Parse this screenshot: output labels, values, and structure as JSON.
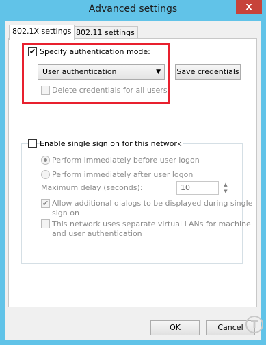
{
  "window": {
    "title": "Advanced settings",
    "close_glyph": "x"
  },
  "tabs": [
    {
      "label": "802.1X settings",
      "active": true
    },
    {
      "label": "802.11 settings",
      "active": false
    }
  ],
  "auth": {
    "specify_label": "Specify authentication mode:",
    "specify_checked": true,
    "mode_value": "User authentication",
    "save_credentials_label": "Save credentials",
    "delete_credentials_label": "Delete credentials for all users",
    "delete_credentials_checked": false
  },
  "sso": {
    "enable_label": "Enable single sign on for this network",
    "enable_checked": false,
    "before_logon_label": "Perform immediately before user logon",
    "before_logon_selected": true,
    "after_logon_label": "Perform immediately after user logon",
    "after_logon_selected": false,
    "max_delay_label": "Maximum delay (seconds):",
    "max_delay_value": "10",
    "allow_dialogs_label_line1": "Allow additional dialogs to be displayed during single",
    "allow_dialogs_label_line2": "sign on",
    "allow_dialogs_checked": true,
    "separate_vlans_label_line1": "This network uses separate virtual LANs for machine",
    "separate_vlans_label_line2": "and user authentication",
    "separate_vlans_checked": false
  },
  "footer": {
    "ok_label": "OK",
    "cancel_label": "Cancel"
  },
  "colors": {
    "frame": "#61c3e8",
    "close_button": "#c7433a",
    "highlight_box": "#e8202e"
  },
  "glyphs": {
    "check": "✔",
    "chevron_down": "▼",
    "spin_up": "▲",
    "spin_down": "▼"
  }
}
